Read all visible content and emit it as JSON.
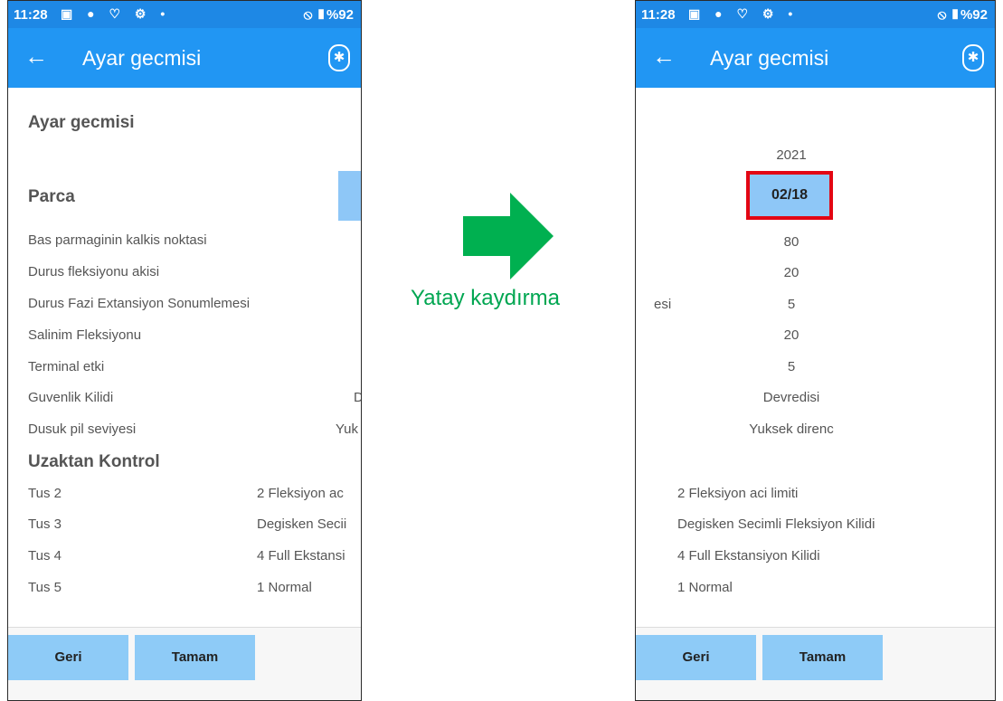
{
  "colors": {
    "status_bar": "#1e88e5",
    "app_bar": "#2196f3",
    "button_fill": "#8ecbf7",
    "highlight_box_border": "#e30613",
    "arrow": "#00b050"
  },
  "status": {
    "time": "11:28",
    "icons": "▣ ● ♡ ⚙ •",
    "right": "⦸ ▮%92"
  },
  "app_bar": {
    "back_icon": "←",
    "title": "Ayar gecmisi",
    "bluetooth_icon": "✱"
  },
  "left_screen": {
    "section_title": "Ayar gecmisi",
    "parca_header": "Parca",
    "parca_items": [
      {
        "label": "Bas parmaginin kalkis noktasi",
        "value": ""
      },
      {
        "label": "Durus  fleksiyonu akisi",
        "value": ""
      },
      {
        "label": "Durus Fazi Extansiyon Sonumlemesi",
        "value": ""
      },
      {
        "label": "Salinim Fleksiyonu",
        "value": ""
      },
      {
        "label": "Terminal etki",
        "value": ""
      },
      {
        "label": "Guvenlik Kilidi",
        "value": "D"
      },
      {
        "label": "Dusuk pil seviyesi",
        "value": "Yuk"
      }
    ],
    "remote_header": "Uzaktan Kontrol",
    "remote_items": [
      {
        "label": "Tus 2",
        "value": "2 Fleksiyon ac"
      },
      {
        "label": "Tus 3",
        "value": "Degisken Secii"
      },
      {
        "label": "Tus 4",
        "value": "4 Full Ekstansi"
      },
      {
        "label": "Tus 5",
        "value": "1 Normal"
      }
    ]
  },
  "right_screen": {
    "year": "2021",
    "date": "02/18",
    "cut_label": "esi",
    "values": [
      "80",
      "20",
      "5",
      "20",
      "5",
      "Devredisi",
      "Yuksek direnc"
    ],
    "remote_values": [
      "2 Fleksiyon aci limiti",
      "Degisken Secimli Fleksiyon Kilidi",
      "4 Full Ekstansiyon Kilidi",
      "1 Normal"
    ]
  },
  "buttons": {
    "back": "Geri",
    "ok": "Tamam"
  },
  "annotation": {
    "label": "Yatay kaydırma"
  }
}
